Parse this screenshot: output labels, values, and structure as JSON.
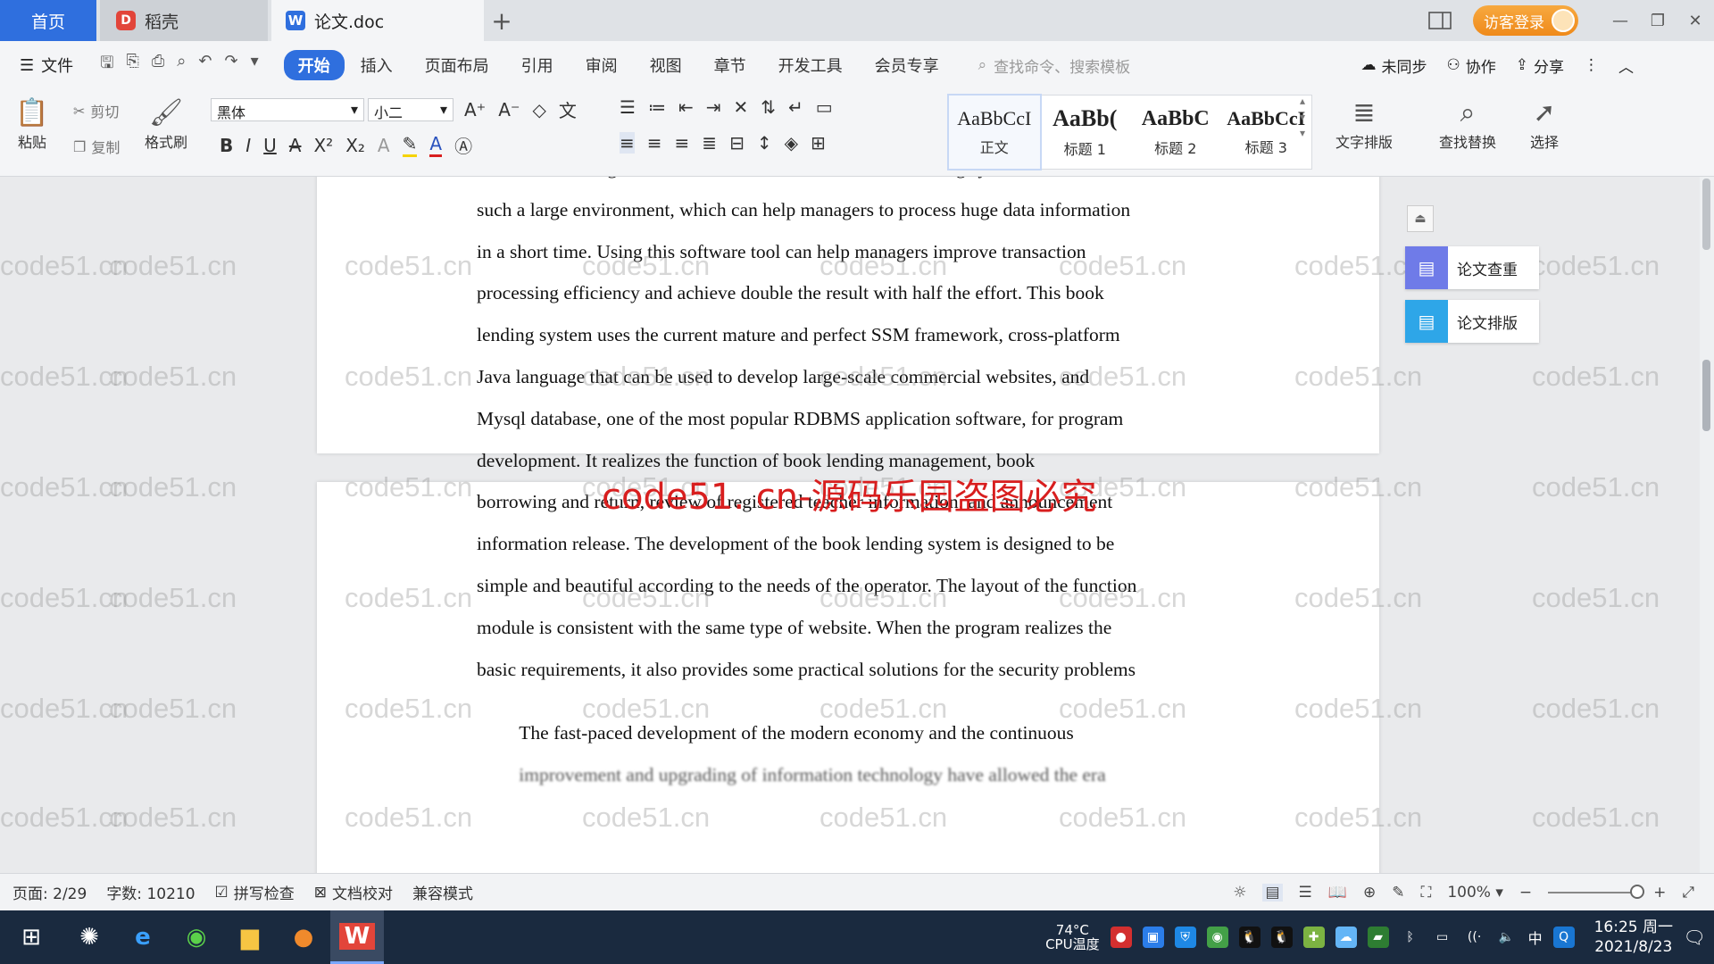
{
  "tabs": {
    "home": "首页",
    "daoke": "稻壳",
    "doc": "论文.doc",
    "add": "+"
  },
  "titlebar": {
    "login": "访客登录"
  },
  "menu": {
    "file": "文件",
    "tabs": [
      "开始",
      "插入",
      "页面布局",
      "引用",
      "审阅",
      "视图",
      "章节",
      "开发工具",
      "会员专享"
    ],
    "search_placeholder": "查找命令、搜索模板",
    "sync": "未同步",
    "collab": "协作",
    "share": "分享"
  },
  "ribbon": {
    "paste": "粘贴",
    "cut": "剪切",
    "copy": "复制",
    "format_painter": "格式刷",
    "font_name": "黑体",
    "font_size": "小二",
    "styles": [
      {
        "sample": "AaBbCcI",
        "name": "正文"
      },
      {
        "sample": "AaBb(",
        "name": "标题 1"
      },
      {
        "sample": "AaBbC",
        "name": "标题 2"
      },
      {
        "sample": "AaBbCcI",
        "name": "标题 3"
      }
    ],
    "text_layout": "文字排版",
    "find_replace": "查找替换",
    "select": "选择"
  },
  "document": {
    "para1_lines": [
      "centralized management of data information. This book lending system was born in",
      "such a large environment, which can help managers to process huge data information",
      "in a short time. Using this software tool can help managers improve transaction",
      "processing efficiency and achieve double the result with half the effort. This book",
      "lending system uses the current mature and perfect SSM framework, cross-platform",
      "Java language that can be used to develop large-scale commercial websites, and",
      "Mysql database, one of the most popular RDBMS application software, for program",
      "development. It realizes the function of book lending management, book",
      "borrowing and return, review of registered teacher information, and announcement",
      "information release. The development of the book lending system is designed to be",
      "simple and beautiful according to the needs of the operator. The layout of the function",
      "module is consistent with the same type of website. When the program realizes the",
      "basic requirements, it also provides some practical solutions for the security problems"
    ],
    "para2_lines": [
      "The fast-paced development of the modern economy and the continuous",
      "improvement and upgrading of information technology have allowed the era"
    ],
    "watermark": "code51.cn",
    "notice": "code51. cn-源码乐园盗图必究"
  },
  "side_panel": {
    "check": "论文查重",
    "layout": "论文排版"
  },
  "statusbar": {
    "page": "页面: 2/29",
    "words": "字数: 10210",
    "spell": "拼写检查",
    "proof": "文档校对",
    "compat": "兼容模式",
    "zoom": "100%"
  },
  "taskbar": {
    "cpu_temp": "74°C",
    "cpu_label": "CPU温度",
    "time": "16:25 周一",
    "date": "2021/8/23",
    "ime": "中"
  }
}
